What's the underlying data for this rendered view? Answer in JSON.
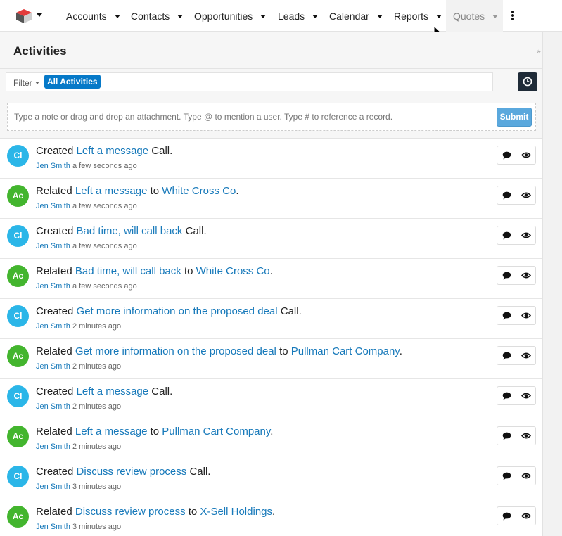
{
  "nav": {
    "items": [
      {
        "label": "Accounts"
      },
      {
        "label": "Contacts"
      },
      {
        "label": "Opportunities"
      },
      {
        "label": "Leads"
      },
      {
        "label": "Calendar"
      },
      {
        "label": "Reports"
      },
      {
        "label": "Quotes",
        "active": true
      }
    ],
    "logo_icon": "cube-logo-icon",
    "more_icon": "kebab-menu-icon"
  },
  "page": {
    "title": "Activities"
  },
  "filter": {
    "label": "Filter",
    "value": "All Activities"
  },
  "composer": {
    "placeholder": "Type a note or drag and drop an attachment. Type @ to mention a user. Type # to reference a record.",
    "submit_label": "Submit"
  },
  "colors": {
    "call_avatar": "#2bb6e8",
    "activity_avatar": "#43b52e",
    "link": "#1779ba",
    "submit": "#5aa8dd"
  },
  "activities": [
    {
      "initials": "Cl",
      "kind": "call",
      "verb": "Created",
      "subject": "Left a message",
      "connector": "",
      "target": "",
      "suffix": "Call.",
      "user": "Jen Smith",
      "time": "a few seconds ago"
    },
    {
      "initials": "Ac",
      "kind": "activity",
      "verb": "Related",
      "subject": "Left a message",
      "connector": "to",
      "target": "White Cross Co",
      "suffix": ".",
      "user": "Jen Smith",
      "time": "a few seconds ago"
    },
    {
      "initials": "Cl",
      "kind": "call",
      "verb": "Created",
      "subject": "Bad time, will call back",
      "connector": "",
      "target": "",
      "suffix": "Call.",
      "user": "Jen Smith",
      "time": "a few seconds ago"
    },
    {
      "initials": "Ac",
      "kind": "activity",
      "verb": "Related",
      "subject": "Bad time, will call back",
      "connector": "to",
      "target": "White Cross Co",
      "suffix": ".",
      "user": "Jen Smith",
      "time": "a few seconds ago"
    },
    {
      "initials": "Cl",
      "kind": "call",
      "verb": "Created",
      "subject": "Get more information on the proposed deal",
      "connector": "",
      "target": "",
      "suffix": "Call.",
      "user": "Jen Smith",
      "time": "2 minutes ago"
    },
    {
      "initials": "Ac",
      "kind": "activity",
      "verb": "Related",
      "subject": "Get more information on the proposed deal",
      "connector": "to",
      "target": "Pullman Cart Company",
      "suffix": ".",
      "user": "Jen Smith",
      "time": "2 minutes ago"
    },
    {
      "initials": "Cl",
      "kind": "call",
      "verb": "Created",
      "subject": "Left a message",
      "connector": "",
      "target": "",
      "suffix": "Call.",
      "user": "Jen Smith",
      "time": "2 minutes ago"
    },
    {
      "initials": "Ac",
      "kind": "activity",
      "verb": "Related",
      "subject": "Left a message",
      "connector": "to",
      "target": "Pullman Cart Company",
      "suffix": ".",
      "user": "Jen Smith",
      "time": "2 minutes ago"
    },
    {
      "initials": "Cl",
      "kind": "call",
      "verb": "Created",
      "subject": "Discuss review process",
      "connector": "",
      "target": "",
      "suffix": "Call.",
      "user": "Jen Smith",
      "time": "3 minutes ago"
    },
    {
      "initials": "Ac",
      "kind": "activity",
      "verb": "Related",
      "subject": "Discuss review process",
      "connector": "to",
      "target": "X-Sell Holdings",
      "suffix": ".",
      "user": "Jen Smith",
      "time": "3 minutes ago"
    }
  ]
}
